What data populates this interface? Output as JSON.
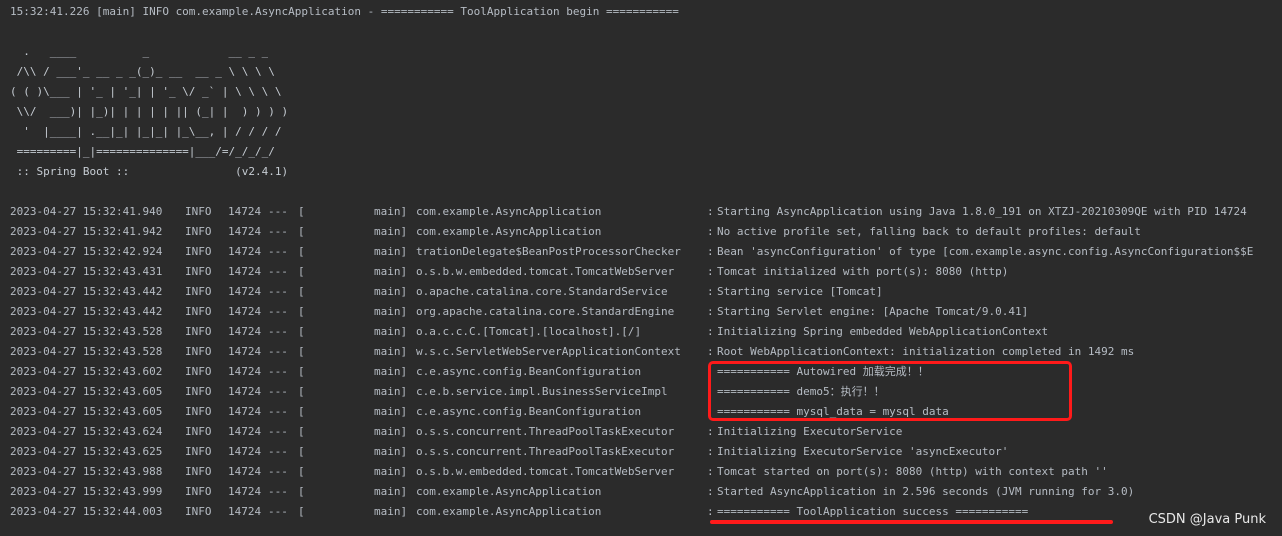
{
  "header_line": "15:32:41.226 [main] INFO com.example.AsyncApplication - =========== ToolApplication begin ===========",
  "banner": [
    "  .   ____          _            __ _ _",
    " /\\\\ / ___'_ __ _ _(_)_ __  __ _ \\ \\ \\ \\",
    "( ( )\\___ | '_ | '_| | '_ \\/ _` | \\ \\ \\ \\",
    " \\\\/  ___)| |_)| | | | | || (_| |  ) ) ) )",
    "  '  |____| .__|_| |_|_| |_\\__, | / / / /",
    " =========|_|==============|___/=/_/_/_/",
    " :: Spring Boot ::                (v2.4.1)"
  ],
  "log_rows": [
    {
      "date": "2023-04-27 15:32:41.940",
      "level": "INFO",
      "pid": "14724",
      "sep": "---",
      "thread": "main]",
      "logger": "com.example.AsyncApplication",
      "message": "Starting AsyncApplication using Java 1.8.0_191 on XTZJ-20210309QE with PID 14724"
    },
    {
      "date": "2023-04-27 15:32:41.942",
      "level": "INFO",
      "pid": "14724",
      "sep": "---",
      "thread": "main]",
      "logger": "com.example.AsyncApplication",
      "message": "No active profile set, falling back to default profiles: default"
    },
    {
      "date": "2023-04-27 15:32:42.924",
      "level": "INFO",
      "pid": "14724",
      "sep": "---",
      "thread": "main]",
      "logger": "trationDelegate$BeanPostProcessorChecker",
      "message": "Bean 'asyncConfiguration' of type [com.example.async.config.AsyncConfiguration$$E"
    },
    {
      "date": "2023-04-27 15:32:43.431",
      "level": "INFO",
      "pid": "14724",
      "sep": "---",
      "thread": "main]",
      "logger": "o.s.b.w.embedded.tomcat.TomcatWebServer",
      "message": "Tomcat initialized with port(s): 8080 (http)"
    },
    {
      "date": "2023-04-27 15:32:43.442",
      "level": "INFO",
      "pid": "14724",
      "sep": "---",
      "thread": "main]",
      "logger": "o.apache.catalina.core.StandardService",
      "message": "Starting service [Tomcat]"
    },
    {
      "date": "2023-04-27 15:32:43.442",
      "level": "INFO",
      "pid": "14724",
      "sep": "---",
      "thread": "main]",
      "logger": "org.apache.catalina.core.StandardEngine",
      "message": "Starting Servlet engine: [Apache Tomcat/9.0.41]"
    },
    {
      "date": "2023-04-27 15:32:43.528",
      "level": "INFO",
      "pid": "14724",
      "sep": "---",
      "thread": "main]",
      "logger": "o.a.c.c.C.[Tomcat].[localhost].[/]",
      "message": "Initializing Spring embedded WebApplicationContext"
    },
    {
      "date": "2023-04-27 15:32:43.528",
      "level": "INFO",
      "pid": "14724",
      "sep": "---",
      "thread": "main]",
      "logger": "w.s.c.ServletWebServerApplicationContext",
      "message": "Root WebApplicationContext: initialization completed in 1492 ms"
    },
    {
      "date": "2023-04-27 15:32:43.602",
      "level": "INFO",
      "pid": "14724",
      "sep": "---",
      "thread": "main]",
      "logger": "c.e.async.config.BeanConfiguration",
      "message": "=========== Autowired 加载完成！！"
    },
    {
      "date": "2023-04-27 15:32:43.605",
      "level": "INFO",
      "pid": "14724",
      "sep": "---",
      "thread": "main]",
      "logger": "c.e.b.service.impl.BusinessServiceImpl",
      "message": "=========== demo5：执行！！"
    },
    {
      "date": "2023-04-27 15:32:43.605",
      "level": "INFO",
      "pid": "14724",
      "sep": "---",
      "thread": "main]",
      "logger": "c.e.async.config.BeanConfiguration",
      "message": "=========== mysql_data = mysql data"
    },
    {
      "date": "2023-04-27 15:32:43.624",
      "level": "INFO",
      "pid": "14724",
      "sep": "---",
      "thread": "main]",
      "logger": "o.s.s.concurrent.ThreadPoolTaskExecutor",
      "message": "Initializing ExecutorService"
    },
    {
      "date": "2023-04-27 15:32:43.625",
      "level": "INFO",
      "pid": "14724",
      "sep": "---",
      "thread": "main]",
      "logger": "o.s.s.concurrent.ThreadPoolTaskExecutor",
      "message": "Initializing ExecutorService 'asyncExecutor'"
    },
    {
      "date": "2023-04-27 15:32:43.988",
      "level": "INFO",
      "pid": "14724",
      "sep": "---",
      "thread": "main]",
      "logger": "o.s.b.w.embedded.tomcat.TomcatWebServer",
      "message": "Tomcat started on port(s): 8080 (http) with context path ''"
    },
    {
      "date": "2023-04-27 15:32:43.999",
      "level": "INFO",
      "pid": "14724",
      "sep": "---",
      "thread": "main]",
      "logger": "com.example.AsyncApplication",
      "message": "Started AsyncApplication in 2.596 seconds (JVM running for 3.0)"
    },
    {
      "date": "2023-04-27 15:32:44.003",
      "level": "INFO",
      "pid": "14724",
      "sep": "---",
      "thread": "main]",
      "logger": "com.example.AsyncApplication",
      "message": "=========== ToolApplication success ==========="
    }
  ],
  "watermark": "CSDN @Java Punk",
  "colors": {
    "background": "#2b2b2b",
    "text": "#b6bcc4",
    "annotation": "#ff1a1a"
  }
}
